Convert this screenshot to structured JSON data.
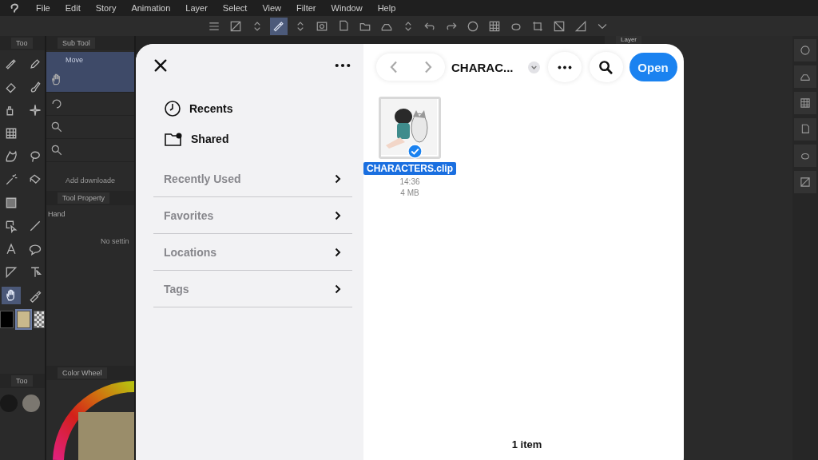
{
  "menu_bar": {
    "items": [
      "File",
      "Edit",
      "Story",
      "Animation",
      "Layer",
      "Select",
      "View",
      "Filter",
      "Window",
      "Help"
    ]
  },
  "toolbar": {
    "tools": [
      {
        "kind": "menu",
        "selected": false
      },
      {
        "kind": "mask",
        "selected": false
      },
      {
        "kind": "updown",
        "selected": false
      },
      {
        "kind": "pen",
        "selected": true
      },
      {
        "kind": "updown",
        "selected": false
      },
      {
        "kind": "swirl",
        "selected": false
      },
      {
        "kind": "doc",
        "selected": false
      },
      {
        "kind": "folder",
        "selected": false
      },
      {
        "kind": "tray",
        "selected": false
      },
      {
        "kind": "updown",
        "selected": false
      },
      {
        "kind": "undo",
        "selected": false
      },
      {
        "kind": "redo",
        "selected": false
      },
      {
        "kind": "dotted",
        "selected": false
      },
      {
        "kind": "grid",
        "selected": false
      },
      {
        "kind": "blob",
        "selected": false
      },
      {
        "kind": "crop",
        "selected": false
      },
      {
        "kind": "diag",
        "selected": false
      },
      {
        "kind": "tri",
        "selected": false
      },
      {
        "kind": "caret",
        "selected": false
      }
    ]
  },
  "tool_panel": {
    "tab": "Too",
    "tools": [
      {
        "kind": "pen",
        "selected": false
      },
      {
        "kind": "pencil",
        "selected": false
      },
      {
        "kind": "eraser",
        "selected": false
      },
      {
        "kind": "brush",
        "selected": false
      },
      {
        "kind": "spray",
        "selected": false
      },
      {
        "kind": "sparkle",
        "selected": false
      },
      {
        "kind": "grid",
        "selected": false
      },
      {
        "kind": "blend",
        "selected": false
      },
      {
        "kind": "lasso",
        "selected": false
      },
      {
        "kind": "wand",
        "selected": false
      },
      {
        "kind": "bucket",
        "selected": false
      },
      {
        "kind": "gradient",
        "selected": false
      },
      {
        "kind": "select",
        "selected": false
      },
      {
        "kind": "line",
        "selected": false
      },
      {
        "kind": "text",
        "selected": false
      },
      {
        "kind": "balloon",
        "selected": false
      },
      {
        "kind": "ruler",
        "selected": false
      },
      {
        "kind": "pointer",
        "selected": false
      },
      {
        "kind": "hand",
        "selected": true
      },
      {
        "kind": "dropper",
        "selected": false
      }
    ],
    "colors": [
      {
        "color": "#000000",
        "selected": false
      },
      {
        "color": "#c9b98c",
        "selected": true
      }
    ]
  },
  "sub_tool": {
    "title": "Sub Tool",
    "group": "Move",
    "items": [
      {
        "kind": "hand",
        "selected": true
      },
      {
        "kind": "rotate",
        "selected": false
      },
      {
        "kind": "zoom",
        "selected": false
      },
      {
        "kind": "zoom",
        "selected": false
      }
    ],
    "add_button": "Add downloade"
  },
  "tool_property": {
    "title": "Tool Property",
    "tool_name": "Hand",
    "message": "No settin"
  },
  "color_panel": {
    "tab": "Too",
    "title": "Color Wheel"
  },
  "layer_panel": {
    "title": "Layer"
  },
  "file_picker": {
    "sidebar": {
      "places": [
        {
          "kind": "recents",
          "label": "Recents"
        },
        {
          "kind": "shared",
          "label": "Shared"
        }
      ],
      "sections": [
        {
          "label": "Recently Used"
        },
        {
          "label": "Favorites"
        },
        {
          "label": "Locations"
        },
        {
          "label": "Tags"
        }
      ]
    },
    "folder_title": "CHARAC...",
    "open_button": "Open",
    "files": [
      {
        "name": "CHARACTERS.clip",
        "time": "14:36",
        "size": "4 MB",
        "selected": true
      }
    ],
    "item_count": "1 item"
  }
}
